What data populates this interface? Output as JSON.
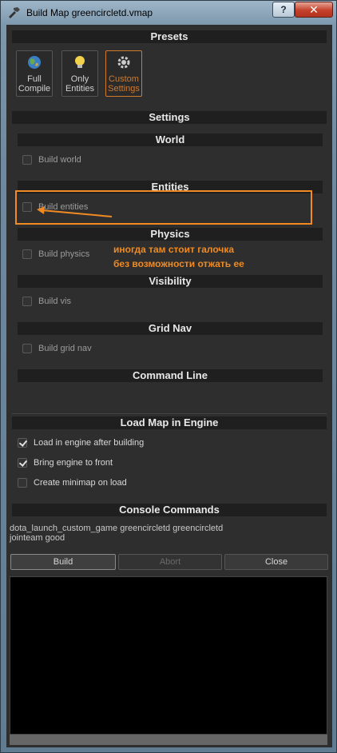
{
  "window": {
    "title": "Build Map greencircletd.vmap",
    "help_glyph": "?",
    "close_glyph": "✕"
  },
  "presets": {
    "header": "Presets",
    "items": [
      {
        "line1": "Full",
        "line2": "Compile",
        "icon": "globe-icon",
        "active": false
      },
      {
        "line1": "Only",
        "line2": "Entities",
        "icon": "lightbulb-icon",
        "active": false
      },
      {
        "line1": "Custom",
        "line2": "Settings",
        "icon": "gear-icon",
        "active": true
      }
    ]
  },
  "settings": {
    "header": "Settings",
    "world": {
      "header": "World",
      "build_label": "Build world",
      "checked": false
    },
    "entities": {
      "header": "Entities",
      "build_label": "Build entities",
      "checked": false
    },
    "physics": {
      "header": "Physics",
      "build_label": "Build physics",
      "checked": false
    },
    "visibility": {
      "header": "Visibility",
      "build_label": "Build vis",
      "checked": false
    },
    "grid_nav": {
      "header": "Grid Nav",
      "build_label": "Build grid nav",
      "checked": false
    },
    "command_line": {
      "header": "Command Line"
    }
  },
  "load_map": {
    "header": "Load Map in Engine",
    "load_after_build": {
      "label": "Load in engine after building",
      "checked": true
    },
    "bring_to_front": {
      "label": "Bring engine to front",
      "checked": true
    },
    "create_minimap": {
      "label": "Create minimap on load",
      "checked": false
    }
  },
  "console": {
    "header": "Console Commands",
    "line1": "dota_launch_custom_game greencircletd greencircletd",
    "line2": "jointeam good"
  },
  "buttons": {
    "build": "Build",
    "abort": "Abort",
    "close": "Close"
  },
  "annotation": {
    "line1": "иногда там стоит галочка",
    "line2": "без возможности отжать ее",
    "color": "#f08a22"
  },
  "colors": {
    "accent": "#d07a2c",
    "panel_bg": "#2e2e2e",
    "header_bg": "#1f1f1f"
  }
}
